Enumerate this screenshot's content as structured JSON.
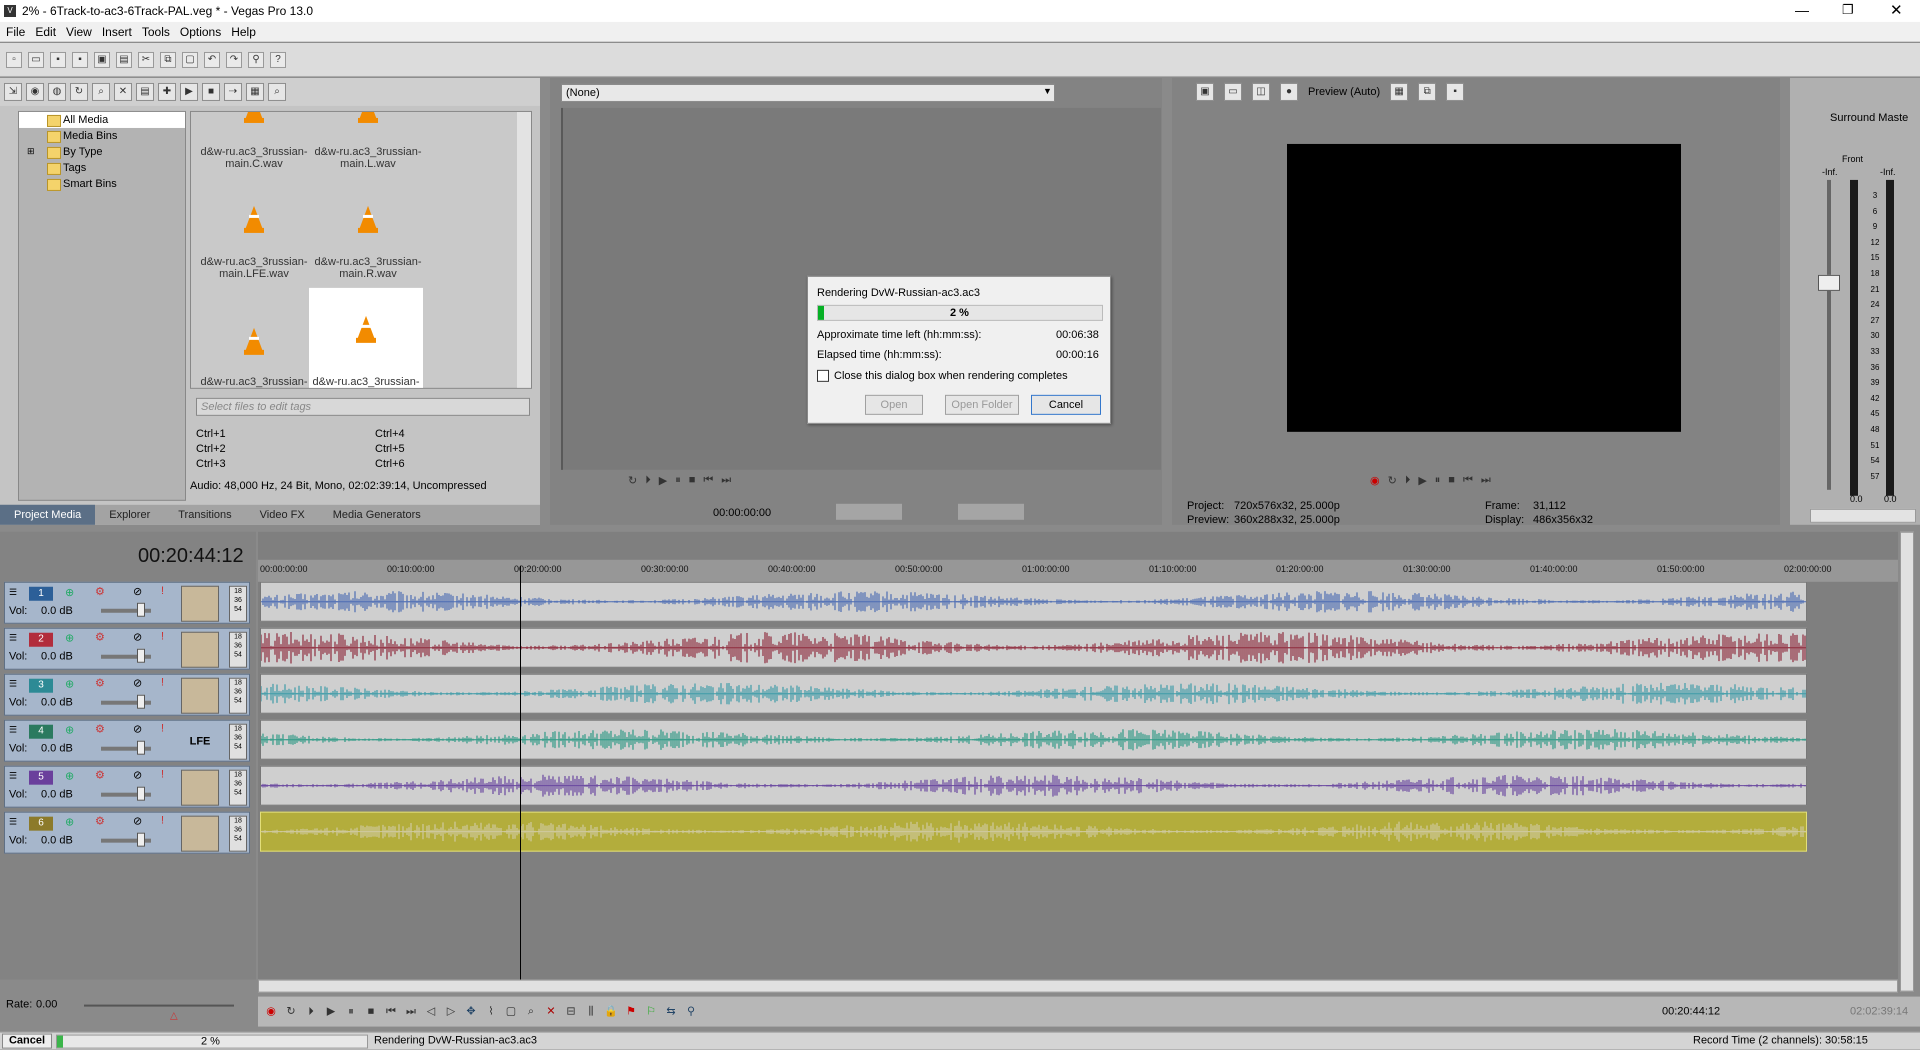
{
  "window": {
    "title": "2% - 6Track-to-ac3-6Track-PAL.veg * - Vegas Pro 13.0"
  },
  "menu": [
    "File",
    "Edit",
    "View",
    "Insert",
    "Tools",
    "Options",
    "Help"
  ],
  "media": {
    "tree": [
      "All Media",
      "Media Bins",
      "By Type",
      "Tags",
      "Smart Bins"
    ],
    "files": [
      "d&w-ru.ac3_3russian-main.C.wav",
      "d&w-ru.ac3_3russian-main.L.wav",
      "d&w-ru.ac3_3russian-main.LFE.wav",
      "d&w-ru.ac3_3russian-main.R.wav",
      "d&w-ru.ac3_3russian-",
      "d&w-ru.ac3_3russian-"
    ],
    "tags_placeholder": "Select files to edit tags",
    "shortcuts": [
      "Ctrl+1",
      "Ctrl+2",
      "Ctrl+3",
      "Ctrl+4",
      "Ctrl+5",
      "Ctrl+6"
    ],
    "info": "Audio: 48,000 Hz, 24 Bit, Mono, 02:02:39:14, Uncompressed",
    "tabs": [
      "Project Media",
      "Explorer",
      "Transitions",
      "Video FX",
      "Media Generators"
    ]
  },
  "trimmer": {
    "selector": "(None)",
    "timecode": "00:00:00:00"
  },
  "preview": {
    "mode": "Preview (Auto)",
    "project_label": "Project:",
    "project": "720x576x32, 25.000p",
    "preview_label": "Preview:",
    "preview_val": "360x288x32, 25.000p",
    "frame_label": "Frame:",
    "frame": "31,112",
    "display_label": "Display:",
    "display": "486x356x32"
  },
  "mixer": {
    "title": "Surround Maste",
    "front": "Front",
    "inf_left": "-Inf.",
    "inf_right": "-Inf.",
    "scale": [
      "3",
      "6",
      "9",
      "12",
      "15",
      "18",
      "21",
      "24",
      "27",
      "30",
      "33",
      "36",
      "39",
      "42",
      "45",
      "48",
      "51",
      "54",
      "57"
    ],
    "bottom_left": "0.0",
    "bottom_right": "0.0"
  },
  "timeline": {
    "timecode": "00:20:44:12",
    "ruler": [
      "00:00:00:00",
      "00:10:00:00",
      "00:20:00:00",
      "00:30:00:00",
      "00:40:00:00",
      "00:50:00:00",
      "01:00:00:00",
      "01:10:00:00",
      "01:20:00:00",
      "01:30:00:00",
      "01:40:00:00",
      "01:50:00:00",
      "02:00:00:00"
    ],
    "tracks": [
      {
        "num": "1",
        "vol_label": "Vol:",
        "vol": "0.0 dB",
        "color": "#4d6db3",
        "hdr": "#2c5f98"
      },
      {
        "num": "2",
        "vol_label": "Vol:",
        "vol": "0.0 dB",
        "color": "#8f2b3d",
        "hdr": "#b22d3c"
      },
      {
        "num": "3",
        "vol_label": "Vol:",
        "vol": "0.0 dB",
        "color": "#3f9ca8",
        "hdr": "#2d8a95"
      },
      {
        "num": "4",
        "vol_label": "Vol:",
        "vol": "0.0 dB",
        "color": "#2f9a86",
        "hdr": "#2b7a5f",
        "lfe": "LFE"
      },
      {
        "num": "5",
        "vol_label": "Vol:",
        "vol": "0.0 dB",
        "color": "#6a47a0",
        "hdr": "#6a3f9c"
      },
      {
        "num": "6",
        "vol_label": "Vol:",
        "vol": "0.0 dB",
        "color": "#cfc9a0",
        "hdr": "#8c7a2a"
      }
    ],
    "meter": [
      "18",
      "36",
      "54"
    ]
  },
  "transport": {
    "rate_label": "Rate:",
    "rate": "0.00",
    "timecode": "00:20:44:12",
    "end": "02:02:39:14"
  },
  "status": {
    "cancel": "Cancel",
    "progress": "2 %",
    "progress_frac": 0.02,
    "message": "Rendering DvW-Russian-ac3.ac3",
    "record": "Record Time (2 channels): 30:58:15"
  },
  "dialog": {
    "title": "Rendering DvW-Russian-ac3.ac3",
    "progress": "2 %",
    "progress_frac": 0.02,
    "time_left_label": "Approximate time left (hh:mm:ss):",
    "time_left": "00:06:38",
    "elapsed_label": "Elapsed time (hh:mm:ss):",
    "elapsed": "00:00:16",
    "checkbox": "Close this dialog box when rendering completes",
    "open": "Open",
    "open_folder": "Open Folder",
    "cancel": "Cancel"
  }
}
